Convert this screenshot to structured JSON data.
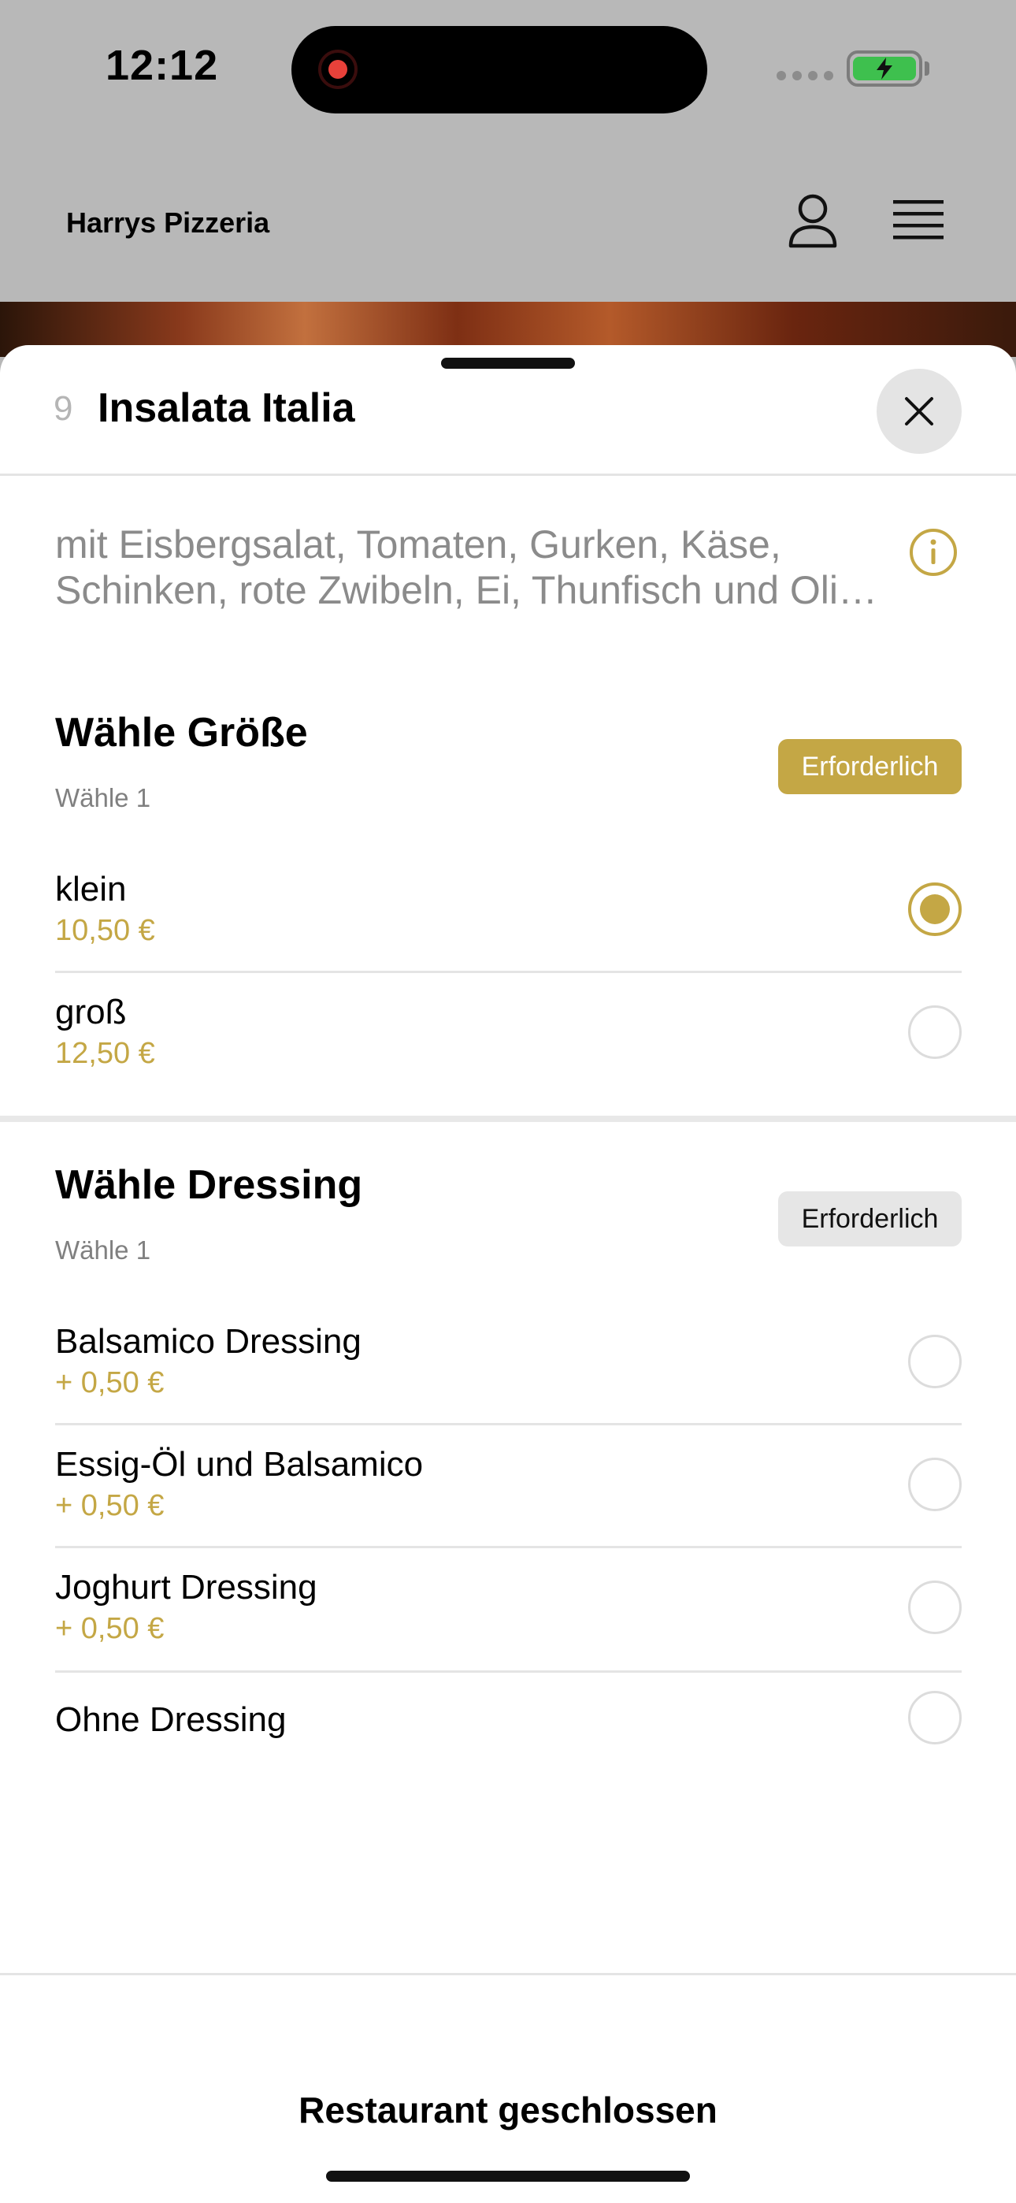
{
  "status": {
    "time": "12:12"
  },
  "header": {
    "brand": "Harrys Pizzeria"
  },
  "item": {
    "number": "9",
    "title": "Insalata Italia",
    "description_line1": "mit Eisbergsalat, Tomaten, Gurken, Käse,",
    "description_line2": "Schinken, rote Zwibeln, Ei, Thunfisch und Oliven"
  },
  "size_group": {
    "title": "Wähle Größe",
    "subtitle": "Wähle 1",
    "badge": "Erforderlich",
    "options": [
      {
        "name": "klein",
        "price": "10,50 €",
        "selected": true
      },
      {
        "name": "groß",
        "price": "12,50 €",
        "selected": false
      }
    ]
  },
  "dressing_group": {
    "title": "Wähle Dressing",
    "subtitle": "Wähle 1",
    "badge": "Erforderlich",
    "options": [
      {
        "name": "Balsamico Dressing",
        "price": "+ 0,50 €"
      },
      {
        "name": "Essig-Öl und Balsamico",
        "price": "+ 0,50 €"
      },
      {
        "name": "Joghurt Dressing",
        "price": "+ 0,50 €"
      },
      {
        "name": "Ohne Dressing",
        "price": ""
      }
    ]
  },
  "footer": {
    "label": "Restaurant geschlossen"
  },
  "colors": {
    "accent": "#c4a745",
    "badge_neutral": "#e6e6e6",
    "backdrop": "#b8b8b8"
  }
}
